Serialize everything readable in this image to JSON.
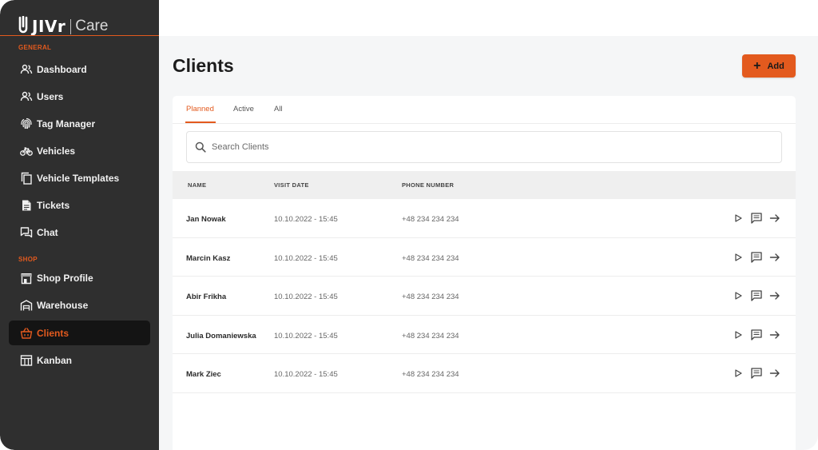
{
  "app": {
    "brand": "JIVr",
    "product": "Care"
  },
  "colors": {
    "accent": "#e35a1e",
    "sidebar_bg": "#2f2f2f",
    "active_bg": "#141414"
  },
  "sidebar": {
    "sections": [
      {
        "label": "GENERAL",
        "items": [
          {
            "label": "Dashboard",
            "icon": "users-icon"
          },
          {
            "label": "Users",
            "icon": "users-icon"
          },
          {
            "label": "Tag Manager",
            "icon": "fingerprint-icon"
          },
          {
            "label": "Vehicles",
            "icon": "bicycle-icon"
          },
          {
            "label": "Vehicle Templates",
            "icon": "copy-icon"
          },
          {
            "label": "Tickets",
            "icon": "document-icon"
          },
          {
            "label": "Chat",
            "icon": "chat-icon"
          }
        ]
      },
      {
        "label": "SHOP",
        "items": [
          {
            "label": "Shop Profile",
            "icon": "storefront-icon"
          },
          {
            "label": "Warehouse",
            "icon": "warehouse-icon"
          },
          {
            "label": "Clients",
            "icon": "basket-icon",
            "active": true
          },
          {
            "label": "Kanban",
            "icon": "kanban-icon"
          }
        ]
      }
    ]
  },
  "main": {
    "title": "Clients",
    "add_label": "Add",
    "tabs": [
      {
        "label": "Planned",
        "active": true
      },
      {
        "label": "Active"
      },
      {
        "label": "All"
      }
    ],
    "search": {
      "placeholder": "Search Clients"
    },
    "table": {
      "columns": [
        "NAME",
        "VISIT DATE",
        "PHONE NUMBER"
      ],
      "rows": [
        {
          "name": "Jan Nowak",
          "visit_date": "10.10.2022 - 15:45",
          "phone": "+48 234 234 234"
        },
        {
          "name": "Marcin Kasz",
          "visit_date": "10.10.2022 - 15:45",
          "phone": "+48 234 234 234"
        },
        {
          "name": "Abir Frikha",
          "visit_date": "10.10.2022 - 15:45",
          "phone": "+48 234 234 234"
        },
        {
          "name": "Julia Domaniewska",
          "visit_date": "10.10.2022 - 15:45",
          "phone": "+48 234 234 234"
        },
        {
          "name": "Mark Ziec",
          "visit_date": "10.10.2022 - 15:45",
          "phone": "+48 234 234 234"
        }
      ],
      "row_actions": [
        "play-icon",
        "comment-icon",
        "arrow-right-icon"
      ]
    }
  }
}
